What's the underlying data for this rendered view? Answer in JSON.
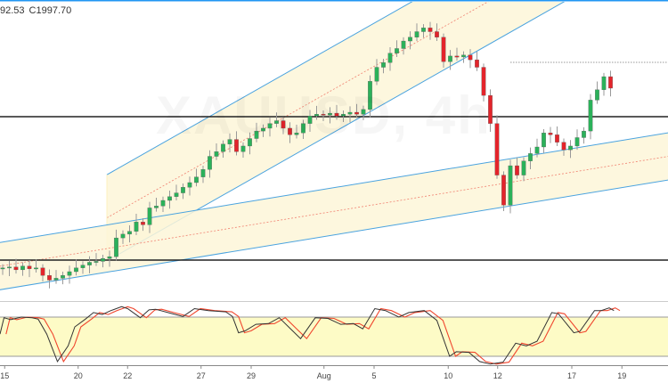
{
  "header": {
    "open_tail": "92.53",
    "close": "C1997.70"
  },
  "watermark": "XAUUSD, 4h",
  "colors": {
    "up": "#2bb15a",
    "down": "#e3242b",
    "channel_line": "#4aa3df",
    "channel_fill": "#fdf6d8",
    "stoch_k": "#333333",
    "stoch_d": "#f0462e",
    "stoch_band": "#fdfbc6"
  },
  "chart_data": {
    "type": "candlestick",
    "symbol": "XAUUSD",
    "timeframe": "4h",
    "first_open": 1805,
    "closes": [
      1806,
      1807,
      1804,
      1808,
      1805,
      1806,
      1798,
      1793,
      1795,
      1798,
      1802,
      1806,
      1809,
      1812,
      1813,
      1816,
      1818,
      1838,
      1842,
      1845,
      1855,
      1852,
      1870,
      1872,
      1878,
      1882,
      1886,
      1892,
      1897,
      1903,
      1911,
      1925,
      1930,
      1938,
      1943,
      1930,
      1936,
      1944,
      1952,
      1955,
      1960,
      1963,
      1955,
      1948,
      1950,
      1960,
      1968,
      1970,
      1969,
      1971,
      1968,
      1970,
      1972,
      1970,
      1975,
      2005,
      2020,
      2025,
      2035,
      2040,
      2048,
      2052,
      2058,
      2062,
      2058,
      2052,
      2026,
      2032,
      2031,
      2033,
      2028,
      2020,
      1990,
      1960,
      1905,
      1873,
      1915,
      1905,
      1920,
      1928,
      1935,
      1950,
      1948,
      1940,
      1932,
      1936,
      1945,
      1952,
      1985,
      1996,
      2010,
      1997.7
    ],
    "wick": 4,
    "ylim": [
      1770,
      2100
    ],
    "x_ticks": [
      {
        "label": "15",
        "bar": 0.3
      },
      {
        "label": "20",
        "bar": 11.3
      },
      {
        "label": "22",
        "bar": 18.7
      },
      {
        "label": "27",
        "bar": 29.7
      },
      {
        "label": "29",
        "bar": 37.2
      },
      {
        "label": "Aug",
        "bar": 48.1
      },
      {
        "label": "5",
        "bar": 55.6
      },
      {
        "label": "10",
        "bar": 66.7
      },
      {
        "label": "12",
        "bar": 74.1
      },
      {
        "label": "17",
        "bar": 85.2
      },
      {
        "label": "19",
        "bar": 92.7
      }
    ],
    "horizontal_levels": [
      1967.3,
      1814.4
    ],
    "last_close_dotted": 2025.25,
    "channels": [
      {
        "name": "rising-channel-steep",
        "start_bar": 15.6,
        "lower_start": 1813.4,
        "slope_per_bar": 4.04,
        "width": 92
      },
      {
        "name": "rising-channel-shallow",
        "start_bar": -1,
        "lower_start": 1782,
        "slope_per_bar": 1.17,
        "width": 50.4
      }
    ],
    "stochastic": {
      "levels": [
        20,
        80
      ],
      "d_lag_bars": 0.9,
      "k": [
        [
          -0.4,
          54
        ],
        [
          0.2,
          79
        ],
        [
          1.2,
          76
        ],
        [
          2.8,
          80
        ],
        [
          4.4,
          79
        ],
        [
          5.3,
          77
        ],
        [
          6.6,
          54
        ],
        [
          8.2,
          12
        ],
        [
          9.8,
          36
        ],
        [
          10.8,
          65
        ],
        [
          12.4,
          77
        ],
        [
          13.6,
          87
        ],
        [
          14.9,
          84
        ],
        [
          16.2,
          90
        ],
        [
          17.8,
          96
        ],
        [
          18.7,
          93
        ],
        [
          20.6,
          79
        ],
        [
          21.9,
          91
        ],
        [
          22.9,
          92
        ],
        [
          25.1,
          86
        ],
        [
          27.0,
          81
        ],
        [
          28.7,
          93
        ],
        [
          30.8,
          90
        ],
        [
          33.4,
          88
        ],
        [
          34.4,
          81
        ],
        [
          35.3,
          56
        ],
        [
          36.3,
          59
        ],
        [
          37.9,
          69
        ],
        [
          39.8,
          70
        ],
        [
          41.4,
          79
        ],
        [
          43.0,
          63
        ],
        [
          44.6,
          47
        ],
        [
          46.8,
          79
        ],
        [
          48.7,
          78
        ],
        [
          50.6,
          69
        ],
        [
          52.5,
          70
        ],
        [
          53.9,
          62
        ],
        [
          55.7,
          93
        ],
        [
          57.3,
          90
        ],
        [
          59.3,
          80
        ],
        [
          60.8,
          87
        ],
        [
          63.1,
          90
        ],
        [
          65.0,
          75
        ],
        [
          66.9,
          20
        ],
        [
          67.9,
          27
        ],
        [
          69.8,
          26
        ],
        [
          71.4,
          12
        ],
        [
          73.0,
          8
        ],
        [
          74.9,
          11
        ],
        [
          76.8,
          40
        ],
        [
          78.4,
          36
        ],
        [
          80.0,
          43
        ],
        [
          82.2,
          87
        ],
        [
          83.2,
          85
        ],
        [
          85.5,
          56
        ],
        [
          86.4,
          58
        ],
        [
          88.6,
          90
        ],
        [
          89.6,
          90
        ],
        [
          90.8,
          94
        ],
        [
          91.5,
          90
        ]
      ]
    }
  }
}
